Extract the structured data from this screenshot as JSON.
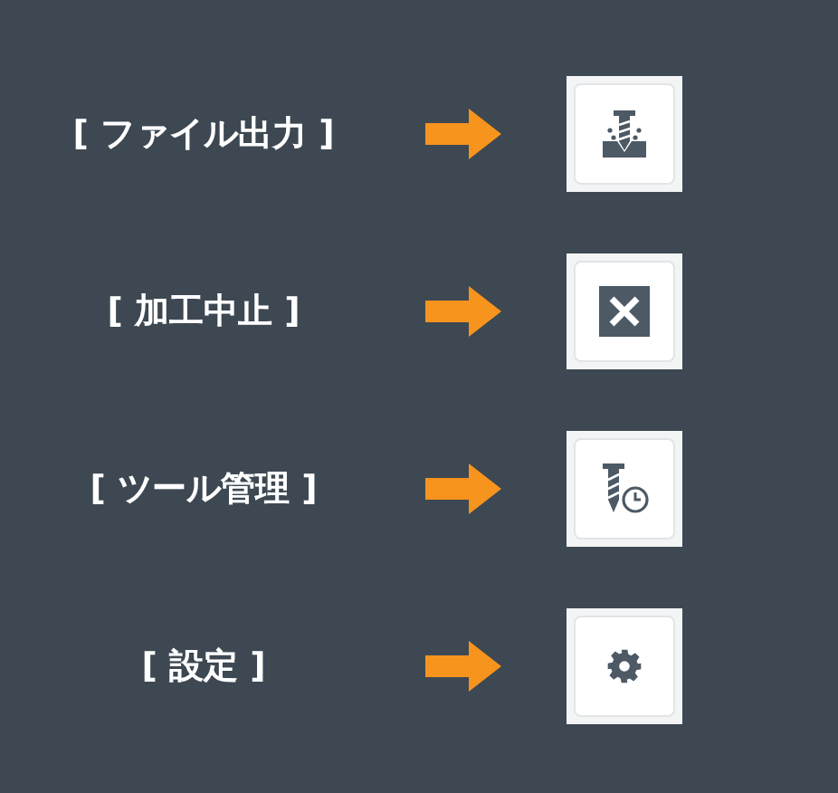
{
  "rows": [
    {
      "label": "[ ファイル出力 ]",
      "kind": "drill"
    },
    {
      "label": "[ 加工中止 ]",
      "kind": "stop"
    },
    {
      "label": "[ ツール管理 ]",
      "kind": "tool"
    },
    {
      "label": "[ 設定 ]",
      "kind": "gear"
    }
  ]
}
